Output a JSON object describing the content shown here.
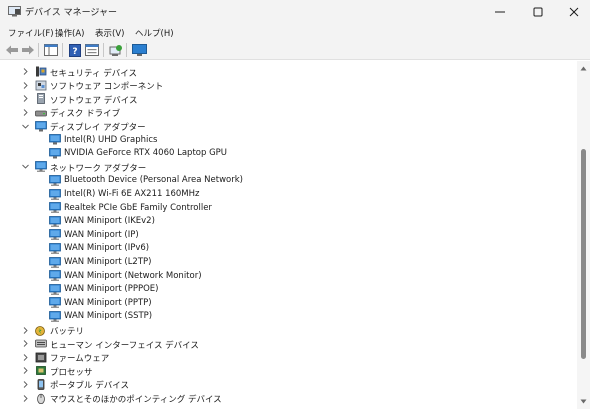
{
  "window": {
    "title": "デバイス マネージャー"
  },
  "menu": [
    {
      "label": "ファイル(F)"
    },
    {
      "label": "操作(A)"
    },
    {
      "label": "表示(V)"
    },
    {
      "label": "ヘルプ(H)"
    }
  ],
  "toolbar": {
    "icons": [
      "back-arrow-icon",
      "forward-arrow-icon",
      "show-hide-console-tree-icon",
      "help-icon",
      "properties-icon",
      "scan-hardware-icon",
      "monitor-icon"
    ]
  },
  "tree": [
    {
      "label": "セキュリティ デバイス",
      "icon": "security-device-icon",
      "level": 0,
      "expander": "collapsed"
    },
    {
      "label": "ソフトウェア コンポーネント",
      "icon": "software-component-icon",
      "level": 0,
      "expander": "collapsed"
    },
    {
      "label": "ソフトウェア デバイス",
      "icon": "software-device-icon",
      "level": 0,
      "expander": "collapsed"
    },
    {
      "label": "ディスク ドライブ",
      "icon": "disk-drive-icon",
      "level": 0,
      "expander": "collapsed"
    },
    {
      "label": "ディスプレイ アダプター",
      "icon": "display-adapter-icon",
      "level": 0,
      "expander": "expanded"
    },
    {
      "label": "Intel(R) UHD Graphics",
      "icon": "display-adapter-icon",
      "level": 1,
      "expander": "none"
    },
    {
      "label": "NVIDIA GeForce RTX 4060 Laptop GPU",
      "icon": "display-adapter-icon",
      "level": 1,
      "expander": "none"
    },
    {
      "label": "ネットワーク アダプター",
      "icon": "network-adapter-icon",
      "level": 0,
      "expander": "expanded"
    },
    {
      "label": "Bluetooth Device (Personal Area Network)",
      "icon": "network-adapter-icon",
      "level": 1,
      "expander": "none"
    },
    {
      "label": "Intel(R) Wi-Fi 6E AX211 160MHz",
      "icon": "network-adapter-icon",
      "level": 1,
      "expander": "none"
    },
    {
      "label": "Realtek PCIe GbE Family Controller",
      "icon": "network-adapter-icon",
      "level": 1,
      "expander": "none"
    },
    {
      "label": "WAN Miniport (IKEv2)",
      "icon": "network-adapter-icon",
      "level": 1,
      "expander": "none"
    },
    {
      "label": "WAN Miniport (IP)",
      "icon": "network-adapter-icon",
      "level": 1,
      "expander": "none"
    },
    {
      "label": "WAN Miniport (IPv6)",
      "icon": "network-adapter-icon",
      "level": 1,
      "expander": "none"
    },
    {
      "label": "WAN Miniport (L2TP)",
      "icon": "network-adapter-icon",
      "level": 1,
      "expander": "none"
    },
    {
      "label": "WAN Miniport (Network Monitor)",
      "icon": "network-adapter-icon",
      "level": 1,
      "expander": "none"
    },
    {
      "label": "WAN Miniport (PPPOE)",
      "icon": "network-adapter-icon",
      "level": 1,
      "expander": "none"
    },
    {
      "label": "WAN Miniport (PPTP)",
      "icon": "network-adapter-icon",
      "level": 1,
      "expander": "none"
    },
    {
      "label": "WAN Miniport (SSTP)",
      "icon": "network-adapter-icon",
      "level": 1,
      "expander": "none"
    },
    {
      "label": "バッテリ",
      "icon": "battery-icon",
      "level": 0,
      "expander": "collapsed"
    },
    {
      "label": "ヒューマン インターフェイス デバイス",
      "icon": "hid-icon",
      "level": 0,
      "expander": "collapsed"
    },
    {
      "label": "ファームウェア",
      "icon": "firmware-icon",
      "level": 0,
      "expander": "collapsed"
    },
    {
      "label": "プロセッサ",
      "icon": "processor-icon",
      "level": 0,
      "expander": "collapsed"
    },
    {
      "label": "ポータブル デバイス",
      "icon": "portable-device-icon",
      "level": 0,
      "expander": "collapsed"
    },
    {
      "label": "マウスとそのほかのポインティング デバイス",
      "icon": "mouse-icon",
      "level": 0,
      "expander": "collapsed"
    }
  ],
  "colors": {
    "chrome": "#f3f3f3",
    "monitor_blue": "#2b7fd0",
    "text": "#1b1b1b"
  }
}
